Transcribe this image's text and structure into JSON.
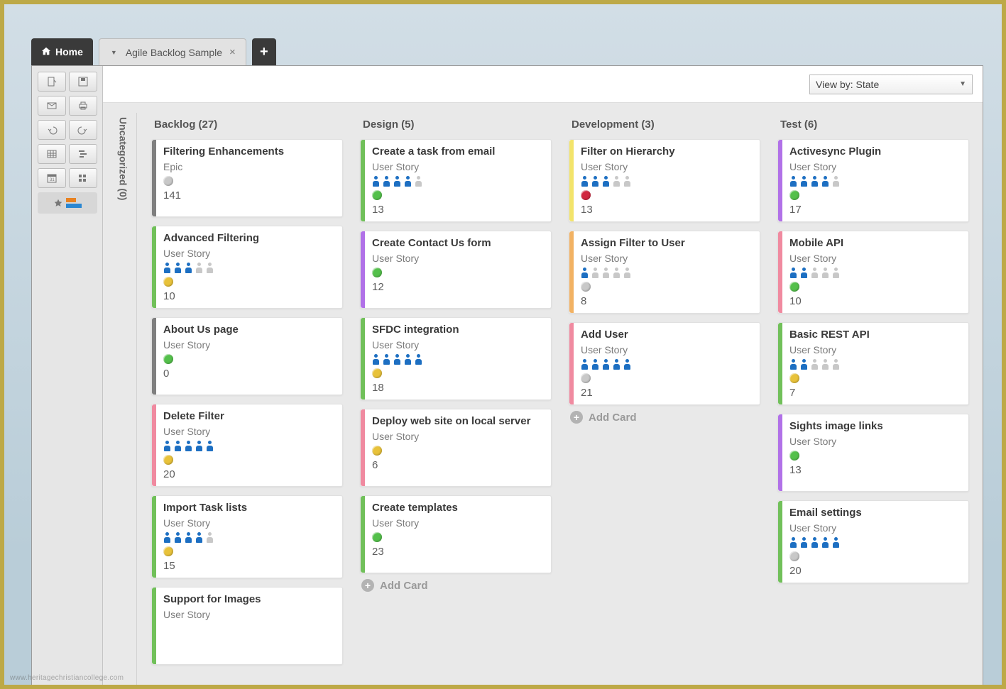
{
  "watermark": "www.heritagechristiancollege.com",
  "tabs": {
    "home": "Home",
    "doc": "Agile Backlog Sample"
  },
  "view_by": "View by: State",
  "stripe_colors": {
    "gray": "#7f7f7f",
    "green": "#71c05a",
    "pink": "#f08aa0",
    "purple": "#b171e8",
    "yellow": "#f3e46b",
    "orange": "#f2b263"
  },
  "status_colors": {
    "gray": "#c8c8c8",
    "green": "#54c04b",
    "yellow": "#e8c23a",
    "red": "#d0263f"
  },
  "person_colors": {
    "active": "#1d6fc2",
    "inactive": "#c8c8c8"
  },
  "uncategorized": {
    "label": "Uncategorized",
    "count": 0
  },
  "columns": [
    {
      "name": "Backlog",
      "count": 27,
      "cards": [
        {
          "title": "Filtering Enhancements",
          "type": "Epic",
          "stripe": "gray",
          "status": "gray",
          "points": 141
        },
        {
          "title": "Advanced Filtering",
          "type": "User Story",
          "stripe": "green",
          "status": "yellow",
          "points": 10,
          "people": [
            1,
            1,
            1,
            0,
            0
          ]
        },
        {
          "title": "About Us page",
          "type": "User Story",
          "stripe": "gray",
          "status": "green",
          "points": 0
        },
        {
          "title": "Delete Filter",
          "type": "User Story",
          "stripe": "pink",
          "status": "yellow",
          "points": 20,
          "people": [
            1,
            1,
            1,
            1,
            1
          ]
        },
        {
          "title": "Import Task lists",
          "type": "User Story",
          "stripe": "green",
          "status": "yellow",
          "points": 15,
          "people": [
            1,
            1,
            1,
            1,
            0
          ]
        },
        {
          "title": "Support for Images",
          "type": "User Story",
          "stripe": "green"
        }
      ],
      "add": false
    },
    {
      "name": "Design",
      "count": 5,
      "cards": [
        {
          "title": "Create a task from email",
          "type": "User Story",
          "stripe": "green",
          "status": "green",
          "points": 13,
          "people": [
            1,
            1,
            1,
            1,
            0
          ]
        },
        {
          "title": "Create Contact Us form",
          "type": "User Story",
          "stripe": "purple",
          "status": "green",
          "points": 12
        },
        {
          "title": "SFDC integration",
          "type": "User Story",
          "stripe": "green",
          "status": "yellow",
          "points": 18,
          "people": [
            1,
            1,
            1,
            1,
            1
          ]
        },
        {
          "title": "Deploy web site on local server",
          "type": "User Story",
          "stripe": "pink",
          "status": "yellow",
          "points": 6
        },
        {
          "title": "Create templates",
          "type": "User Story",
          "stripe": "green",
          "status": "green",
          "points": 23
        }
      ],
      "add": true,
      "add_label": "Add Card"
    },
    {
      "name": "Development",
      "count": 3,
      "cards": [
        {
          "title": "Filter on Hierarchy",
          "type": "User Story",
          "stripe": "yellow",
          "status": "red",
          "points": 13,
          "people": [
            1,
            1,
            1,
            0,
            0
          ]
        },
        {
          "title": "Assign Filter to User",
          "type": "User Story",
          "stripe": "orange",
          "status": "gray",
          "points": 8,
          "people": [
            1,
            0,
            0,
            0,
            0
          ]
        },
        {
          "title": "Add User",
          "type": "User Story",
          "stripe": "pink",
          "status": "gray",
          "points": 21,
          "people": [
            1,
            1,
            1,
            1,
            1
          ]
        }
      ],
      "add": true,
      "add_label": "Add Card"
    },
    {
      "name": "Test",
      "count": 6,
      "cards": [
        {
          "title": "Activesync Plugin",
          "type": "User Story",
          "stripe": "purple",
          "status": "green",
          "points": 17,
          "people": [
            1,
            1,
            1,
            1,
            0
          ]
        },
        {
          "title": "Mobile API",
          "type": "User Story",
          "stripe": "pink",
          "status": "green",
          "points": 10,
          "people": [
            1,
            1,
            0,
            0,
            0
          ]
        },
        {
          "title": "Basic REST API",
          "type": "User Story",
          "stripe": "green",
          "status": "yellow",
          "points": 7,
          "people": [
            1,
            1,
            0,
            0,
            0
          ]
        },
        {
          "title": "Sights image links",
          "type": "User Story",
          "stripe": "purple",
          "status": "green",
          "points": 13
        },
        {
          "title": "Email settings",
          "type": "User Story",
          "stripe": "green",
          "status": "gray",
          "points": 20,
          "people": [
            1,
            1,
            1,
            1,
            1
          ]
        }
      ],
      "add": false
    }
  ]
}
